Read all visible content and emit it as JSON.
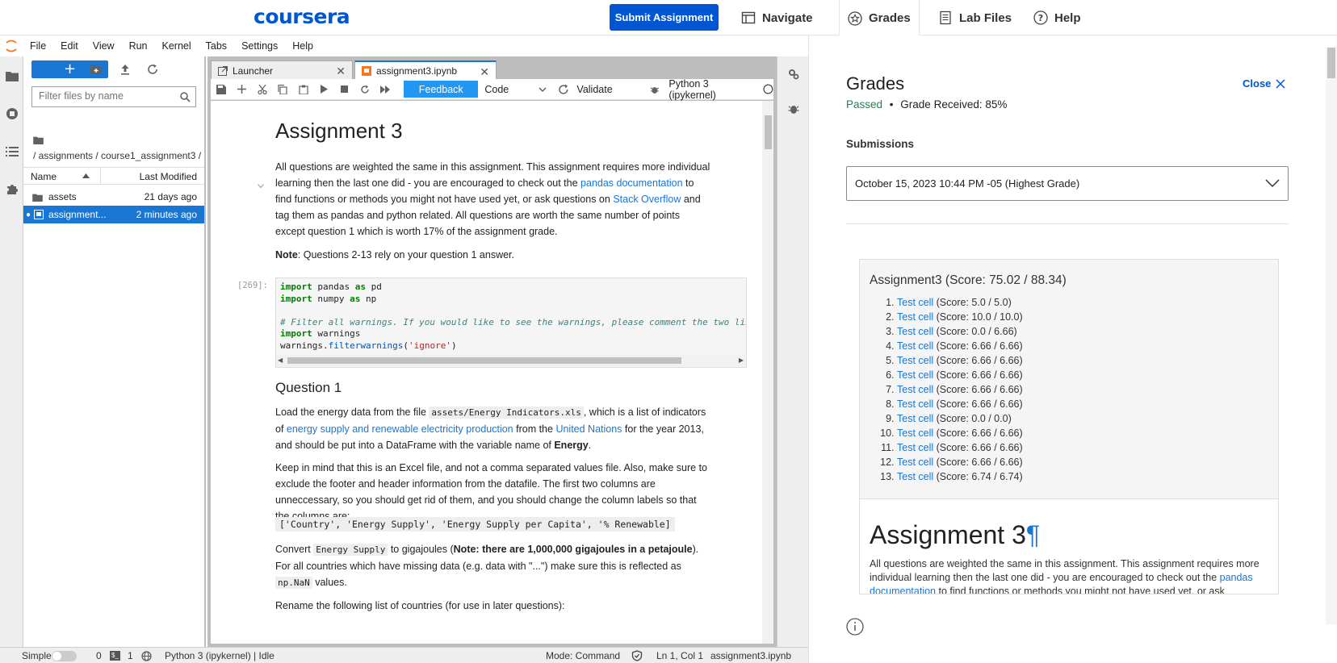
{
  "topbar": {
    "logo": "coursera",
    "submit_label": "Submit Assignment",
    "nav": [
      {
        "label": "Navigate",
        "icon": "navigate-icon"
      },
      {
        "label": "Grades",
        "icon": "star-icon"
      },
      {
        "label": "Lab Files",
        "icon": "document-icon"
      },
      {
        "label": "Help",
        "icon": "help-icon"
      }
    ]
  },
  "menu": [
    "File",
    "Edit",
    "View",
    "Run",
    "Kernel",
    "Tabs",
    "Settings",
    "Help"
  ],
  "filebrowser": {
    "new_label": "+",
    "filter_placeholder": "Filter files by name",
    "path": "/ assignments / course1_assignment3 /",
    "col_name": "Name",
    "col_modified": "Last Modified",
    "rows": [
      {
        "name": "assets",
        "modified": "21 days ago"
      },
      {
        "name": "assignment...",
        "modified": "2 minutes ago"
      }
    ]
  },
  "tabs": [
    {
      "label": "Launcher"
    },
    {
      "label": "assignment3.ipynb"
    }
  ],
  "nbtoolbar": {
    "feedback": "Feedback",
    "celltype": "Code",
    "validate": "Validate",
    "kernel": "Python 3 (ipykernel)"
  },
  "notebook": {
    "title": "Assignment 3",
    "intro": {
      "p1": "All questions are weighted the same in this assignment. This assignment requires more individual learning then the last one did - you are encouraged to check out the ",
      "link1": "pandas documentation",
      "p2": " to find functions or methods you might not have used yet, or ask questions on ",
      "link2": "Stack Overflow",
      "p3": " and tag them as pandas and python related. All questions are worth the same number of points except question 1 which is worth 17% of the assignment grade."
    },
    "note_bold": "Note",
    "note_text": ": Questions 2-13 rely on your question 1 answer.",
    "prompt": "[269]:",
    "code": {
      "import": "import",
      "as": "as",
      "pandas": " pandas ",
      "pd": " pd",
      "numpy": " numpy ",
      "np": " np",
      "comment": "# Filter all warnings. If you would like to see the warnings, please comment the two lines",
      "warnings": " warnings",
      "call_obj": "warnings.",
      "call_fn": "filterwarnings",
      "call_open": "(",
      "call_arg": "'ignore'",
      "call_close": ")"
    },
    "q1_title": "Question 1",
    "q1": {
      "a": "Load the energy data from the file ",
      "file": "assets/Energy Indicators.xls",
      "b": ", which is a list of indicators of ",
      "link1": "energy supply and renewable electricity production",
      "c": " from the ",
      "link2": "United Nations",
      "d": " for the year 2013, and should be put into a DataFrame with the variable name of ",
      "var": "Energy",
      "e": "."
    },
    "q1_p2": "Keep in mind that this is an Excel file, and not a comma separated values file. Also, make sure to exclude the footer and header information from the datafile. The first two columns are unneccessary, so you should get rid of them, and you should change the column labels so that the columns are:",
    "columns_code": "['Country', 'Energy Supply', 'Energy Supply per Capita', '% Renewable]",
    "q1_p3": {
      "a": "Convert ",
      "code1": "Energy Supply",
      "b": " to gigajoules (",
      "bold": "Note: there are 1,000,000 gigajoules in a petajoule",
      "c": "). For all countries which have missing data (e.g. data with \"...\") make sure this is reflected as ",
      "code2": "np.NaN",
      "d": " values."
    },
    "q1_p4": "Rename the following list of countries (for use in later questions):"
  },
  "statusbar": {
    "mode": "Simple",
    "n1": "0",
    "n2": "1",
    "kernel": "Python 3 (ipykernel) | Idle",
    "cmd": "Mode: Command",
    "pos": "Ln 1, Col 1",
    "file": "assignment3.ipynb"
  },
  "grades": {
    "title": "Grades",
    "close": "Close",
    "passed": "Passed",
    "sep": "•",
    "received": "Grade Received: 85%",
    "submissions_label": "Submissions",
    "submission": "October 15, 2023 10:44 PM -05 (Highest Grade)",
    "report_title": "Assignment3 (Score: 75.02 / 88.34)",
    "test_cell_label": "Test cell",
    "scores": [
      " (Score: 5.0 / 5.0)",
      " (Score: 10.0 / 10.0)",
      " (Score: 0.0 / 6.66)",
      " (Score: 6.66 / 6.66)",
      " (Score: 6.66 / 6.66)",
      " (Score: 6.66 / 6.66)",
      " (Score: 6.66 / 6.66)",
      " (Score: 6.66 / 6.66)",
      " (Score: 0.0 / 0.0)",
      " (Score: 6.66 / 6.66)",
      " (Score: 6.66 / 6.66)",
      " (Score: 6.66 / 6.66)",
      " (Score: 6.74 / 6.74)"
    ],
    "report_h1": "Assignment 3",
    "pilcrow": "¶",
    "report_para": "All questions are weighted the same in this assignment. This assignment requires more individual learning then the last one did - you are encouraged to check out the ",
    "report_link": "pandas documentation",
    "report_para2": " to find functions or methods you might not have used yet, or ask"
  },
  "colors": {
    "coursera_blue": "#0056d2",
    "jupyter_blue": "#1976d2",
    "passed_green": "#1f8354"
  }
}
